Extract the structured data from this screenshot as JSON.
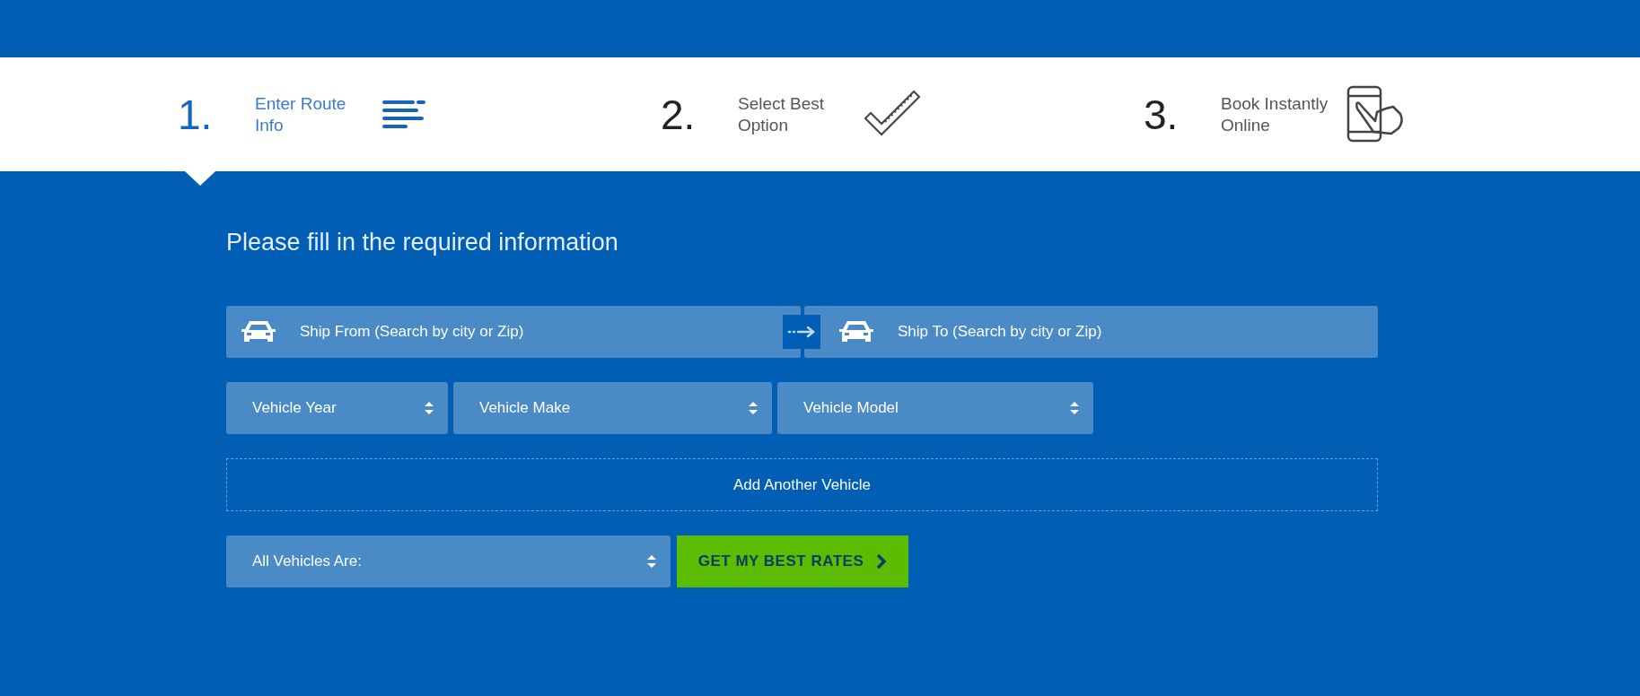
{
  "steps": [
    {
      "number": "1.",
      "label": "Enter Route Info",
      "selected": true
    },
    {
      "number": "2.",
      "label": "Select Best Option",
      "selected": false
    },
    {
      "number": "3.",
      "label": "Book Instantly Online",
      "selected": false
    }
  ],
  "form": {
    "heading": "Please fill in the required information",
    "ship_from": {
      "placeholder": "Ship From (Search by city or Zip)"
    },
    "ship_to": {
      "placeholder": "Ship To (Search by city or Zip)"
    },
    "vehicle_selects": [
      "Vehicle Year",
      "Vehicle Make",
      "Vehicle Model"
    ],
    "add_vehicle": "Add Another Vehicle",
    "vehicle_type_select": "All Vehicles Are:",
    "submit": "GET MY BEST RATES"
  }
}
